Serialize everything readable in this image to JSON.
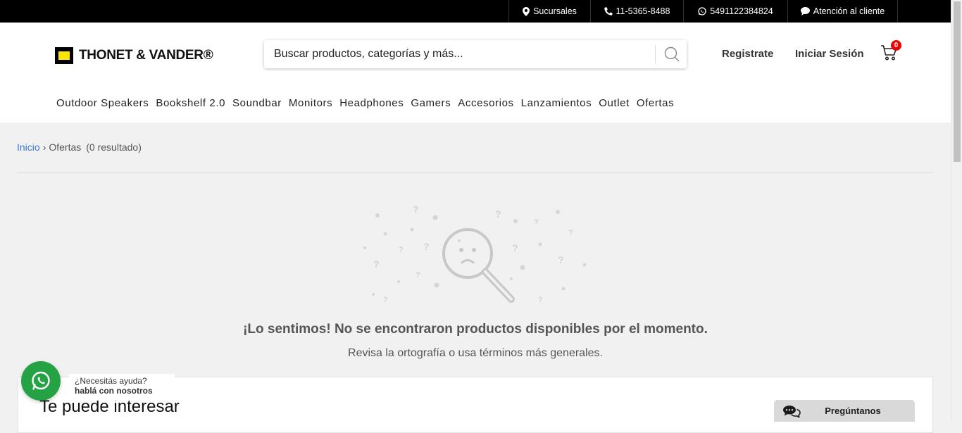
{
  "topbar": {
    "branches": "Sucursales",
    "phone": "11-5365-8488",
    "whatsapp": "5491122384824",
    "support": "Atención al cliente"
  },
  "header": {
    "logo_text": "THONET & VANDER®",
    "search_placeholder": "Buscar productos, categorías y más...",
    "register": "Registrate",
    "login": "Iniciar Sesión",
    "cart_count": "0"
  },
  "nav": {
    "items": [
      "Outdoor Speakers",
      "Bookshelf 2.0",
      "Soundbar",
      "Monitors",
      "Headphones",
      "Gamers",
      "Accesorios",
      "Lanzamientos",
      "Outlet",
      "Ofertas"
    ]
  },
  "breadcrumb": {
    "home": "Inicio",
    "separator": "›",
    "current": "Ofertas",
    "results": "(0 resultado)"
  },
  "empty_state": {
    "title": "¡Lo sentimos! No se encontraron productos disponibles por el momento.",
    "subtitle": "Revisa la ortografía o usa términos más generales."
  },
  "suggestions": {
    "title": "Te puede interesar"
  },
  "whatsapp_widget": {
    "text_plain": "¿Necesitás ayuda?",
    "text_bold": "hablá con nosotros"
  },
  "ask_tab": {
    "label": "Pregúntanos"
  },
  "colors": {
    "topbar_bg": "#000000",
    "logo_yellow": "#ffe600",
    "link_blue": "#3a7bd5",
    "cart_badge": "#ee0000",
    "whatsapp_green": "#25a244"
  }
}
